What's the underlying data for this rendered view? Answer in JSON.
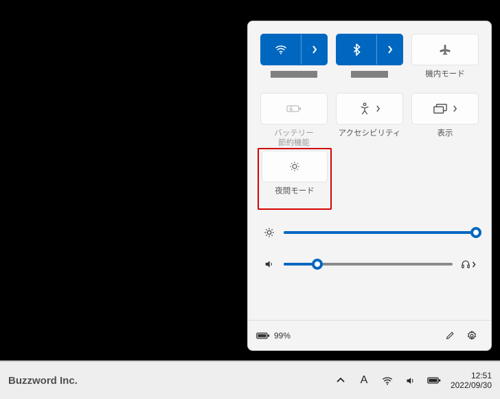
{
  "panel": {
    "tiles": {
      "wifi": {
        "label_redacted": true
      },
      "bluetooth": {
        "label_redacted": true
      },
      "airplane": {
        "label": "機内モード"
      },
      "battery": {
        "label": "バッテリー\n節約機能"
      },
      "accessibility": {
        "label": "アクセシビリティ"
      },
      "display": {
        "label": "表示"
      },
      "night": {
        "label": "夜間モード"
      }
    },
    "brightness_pct": 100,
    "volume_pct": 20,
    "footer": {
      "battery_text": "99%"
    }
  },
  "taskbar": {
    "brand": "Buzzword Inc.",
    "ime": "A",
    "time": "12:51",
    "date": "2022/09/30"
  }
}
